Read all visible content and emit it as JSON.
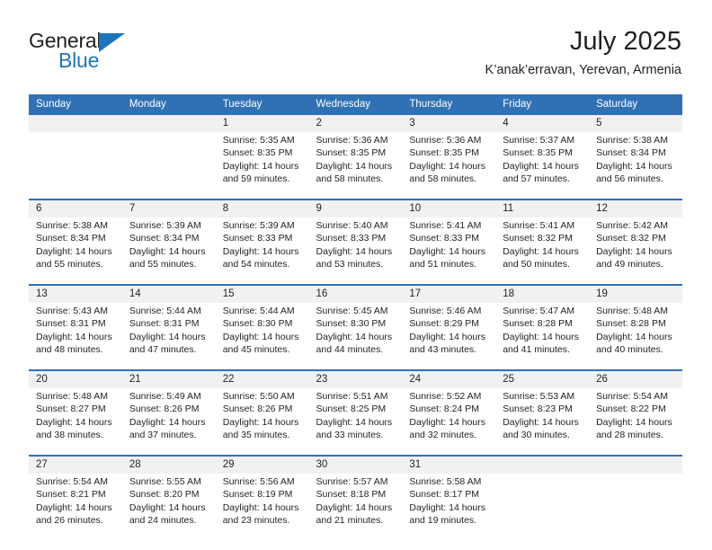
{
  "brand": {
    "name_part1": "General",
    "name_part2": "Blue",
    "triangle_color": "#1b75bb"
  },
  "header": {
    "title": "July 2025",
    "subtitle": "K’anak’erravan, Yerevan, Armenia",
    "accent_color": "#3071b5",
    "date_band_color": "#f1f1f1"
  },
  "calendar": {
    "weekday_headers": [
      "Sunday",
      "Monday",
      "Tuesday",
      "Wednesday",
      "Thursday",
      "Friday",
      "Saturday"
    ],
    "labels": {
      "sunrise": "Sunrise:",
      "sunset": "Sunset:",
      "daylight": "Daylight:"
    },
    "weeks": [
      [
        {
          "day": "",
          "sunrise": "",
          "sunset": "",
          "daylight_line1": "",
          "daylight_line2": ""
        },
        {
          "day": "",
          "sunrise": "",
          "sunset": "",
          "daylight_line1": "",
          "daylight_line2": ""
        },
        {
          "day": "1",
          "sunrise": "Sunrise: 5:35 AM",
          "sunset": "Sunset: 8:35 PM",
          "daylight_line1": "Daylight: 14 hours",
          "daylight_line2": "and 59 minutes."
        },
        {
          "day": "2",
          "sunrise": "Sunrise: 5:36 AM",
          "sunset": "Sunset: 8:35 PM",
          "daylight_line1": "Daylight: 14 hours",
          "daylight_line2": "and 58 minutes."
        },
        {
          "day": "3",
          "sunrise": "Sunrise: 5:36 AM",
          "sunset": "Sunset: 8:35 PM",
          "daylight_line1": "Daylight: 14 hours",
          "daylight_line2": "and 58 minutes."
        },
        {
          "day": "4",
          "sunrise": "Sunrise: 5:37 AM",
          "sunset": "Sunset: 8:35 PM",
          "daylight_line1": "Daylight: 14 hours",
          "daylight_line2": "and 57 minutes."
        },
        {
          "day": "5",
          "sunrise": "Sunrise: 5:38 AM",
          "sunset": "Sunset: 8:34 PM",
          "daylight_line1": "Daylight: 14 hours",
          "daylight_line2": "and 56 minutes."
        }
      ],
      [
        {
          "day": "6",
          "sunrise": "Sunrise: 5:38 AM",
          "sunset": "Sunset: 8:34 PM",
          "daylight_line1": "Daylight: 14 hours",
          "daylight_line2": "and 55 minutes."
        },
        {
          "day": "7",
          "sunrise": "Sunrise: 5:39 AM",
          "sunset": "Sunset: 8:34 PM",
          "daylight_line1": "Daylight: 14 hours",
          "daylight_line2": "and 55 minutes."
        },
        {
          "day": "8",
          "sunrise": "Sunrise: 5:39 AM",
          "sunset": "Sunset: 8:33 PM",
          "daylight_line1": "Daylight: 14 hours",
          "daylight_line2": "and 54 minutes."
        },
        {
          "day": "9",
          "sunrise": "Sunrise: 5:40 AM",
          "sunset": "Sunset: 8:33 PM",
          "daylight_line1": "Daylight: 14 hours",
          "daylight_line2": "and 53 minutes."
        },
        {
          "day": "10",
          "sunrise": "Sunrise: 5:41 AM",
          "sunset": "Sunset: 8:33 PM",
          "daylight_line1": "Daylight: 14 hours",
          "daylight_line2": "and 51 minutes."
        },
        {
          "day": "11",
          "sunrise": "Sunrise: 5:41 AM",
          "sunset": "Sunset: 8:32 PM",
          "daylight_line1": "Daylight: 14 hours",
          "daylight_line2": "and 50 minutes."
        },
        {
          "day": "12",
          "sunrise": "Sunrise: 5:42 AM",
          "sunset": "Sunset: 8:32 PM",
          "daylight_line1": "Daylight: 14 hours",
          "daylight_line2": "and 49 minutes."
        }
      ],
      [
        {
          "day": "13",
          "sunrise": "Sunrise: 5:43 AM",
          "sunset": "Sunset: 8:31 PM",
          "daylight_line1": "Daylight: 14 hours",
          "daylight_line2": "and 48 minutes."
        },
        {
          "day": "14",
          "sunrise": "Sunrise: 5:44 AM",
          "sunset": "Sunset: 8:31 PM",
          "daylight_line1": "Daylight: 14 hours",
          "daylight_line2": "and 47 minutes."
        },
        {
          "day": "15",
          "sunrise": "Sunrise: 5:44 AM",
          "sunset": "Sunset: 8:30 PM",
          "daylight_line1": "Daylight: 14 hours",
          "daylight_line2": "and 45 minutes."
        },
        {
          "day": "16",
          "sunrise": "Sunrise: 5:45 AM",
          "sunset": "Sunset: 8:30 PM",
          "daylight_line1": "Daylight: 14 hours",
          "daylight_line2": "and 44 minutes."
        },
        {
          "day": "17",
          "sunrise": "Sunrise: 5:46 AM",
          "sunset": "Sunset: 8:29 PM",
          "daylight_line1": "Daylight: 14 hours",
          "daylight_line2": "and 43 minutes."
        },
        {
          "day": "18",
          "sunrise": "Sunrise: 5:47 AM",
          "sunset": "Sunset: 8:28 PM",
          "daylight_line1": "Daylight: 14 hours",
          "daylight_line2": "and 41 minutes."
        },
        {
          "day": "19",
          "sunrise": "Sunrise: 5:48 AM",
          "sunset": "Sunset: 8:28 PM",
          "daylight_line1": "Daylight: 14 hours",
          "daylight_line2": "and 40 minutes."
        }
      ],
      [
        {
          "day": "20",
          "sunrise": "Sunrise: 5:48 AM",
          "sunset": "Sunset: 8:27 PM",
          "daylight_line1": "Daylight: 14 hours",
          "daylight_line2": "and 38 minutes."
        },
        {
          "day": "21",
          "sunrise": "Sunrise: 5:49 AM",
          "sunset": "Sunset: 8:26 PM",
          "daylight_line1": "Daylight: 14 hours",
          "daylight_line2": "and 37 minutes."
        },
        {
          "day": "22",
          "sunrise": "Sunrise: 5:50 AM",
          "sunset": "Sunset: 8:26 PM",
          "daylight_line1": "Daylight: 14 hours",
          "daylight_line2": "and 35 minutes."
        },
        {
          "day": "23",
          "sunrise": "Sunrise: 5:51 AM",
          "sunset": "Sunset: 8:25 PM",
          "daylight_line1": "Daylight: 14 hours",
          "daylight_line2": "and 33 minutes."
        },
        {
          "day": "24",
          "sunrise": "Sunrise: 5:52 AM",
          "sunset": "Sunset: 8:24 PM",
          "daylight_line1": "Daylight: 14 hours",
          "daylight_line2": "and 32 minutes."
        },
        {
          "day": "25",
          "sunrise": "Sunrise: 5:53 AM",
          "sunset": "Sunset: 8:23 PM",
          "daylight_line1": "Daylight: 14 hours",
          "daylight_line2": "and 30 minutes."
        },
        {
          "day": "26",
          "sunrise": "Sunrise: 5:54 AM",
          "sunset": "Sunset: 8:22 PM",
          "daylight_line1": "Daylight: 14 hours",
          "daylight_line2": "and 28 minutes."
        }
      ],
      [
        {
          "day": "27",
          "sunrise": "Sunrise: 5:54 AM",
          "sunset": "Sunset: 8:21 PM",
          "daylight_line1": "Daylight: 14 hours",
          "daylight_line2": "and 26 minutes."
        },
        {
          "day": "28",
          "sunrise": "Sunrise: 5:55 AM",
          "sunset": "Sunset: 8:20 PM",
          "daylight_line1": "Daylight: 14 hours",
          "daylight_line2": "and 24 minutes."
        },
        {
          "day": "29",
          "sunrise": "Sunrise: 5:56 AM",
          "sunset": "Sunset: 8:19 PM",
          "daylight_line1": "Daylight: 14 hours",
          "daylight_line2": "and 23 minutes."
        },
        {
          "day": "30",
          "sunrise": "Sunrise: 5:57 AM",
          "sunset": "Sunset: 8:18 PM",
          "daylight_line1": "Daylight: 14 hours",
          "daylight_line2": "and 21 minutes."
        },
        {
          "day": "31",
          "sunrise": "Sunrise: 5:58 AM",
          "sunset": "Sunset: 8:17 PM",
          "daylight_line1": "Daylight: 14 hours",
          "daylight_line2": "and 19 minutes."
        },
        {
          "day": "",
          "sunrise": "",
          "sunset": "",
          "daylight_line1": "",
          "daylight_line2": ""
        },
        {
          "day": "",
          "sunrise": "",
          "sunset": "",
          "daylight_line1": "",
          "daylight_line2": ""
        }
      ]
    ]
  }
}
